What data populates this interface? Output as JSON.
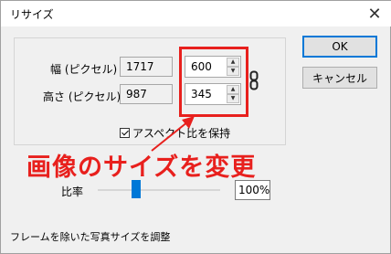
{
  "window": {
    "title": "リサイズ",
    "close_glyph": "✕"
  },
  "buttons": {
    "ok": "OK",
    "cancel": "キャンセル"
  },
  "width_row": {
    "label": "幅 (ピクセル)",
    "original": "1717",
    "value": "600"
  },
  "height_row": {
    "label": "高さ (ピクセル)",
    "original": "987",
    "value": "345"
  },
  "aspect": {
    "label": "アスペクト比を保持",
    "checked": true
  },
  "annotation": {
    "text": "画像のサイズを変更",
    "color": "#e8201d"
  },
  "ratio": {
    "label": "比率",
    "value": "100%"
  },
  "footer": {
    "text": "フレームを除いた写真サイズを調整"
  },
  "colors": {
    "accent": "#0078d7",
    "highlight": "#e8201d"
  }
}
